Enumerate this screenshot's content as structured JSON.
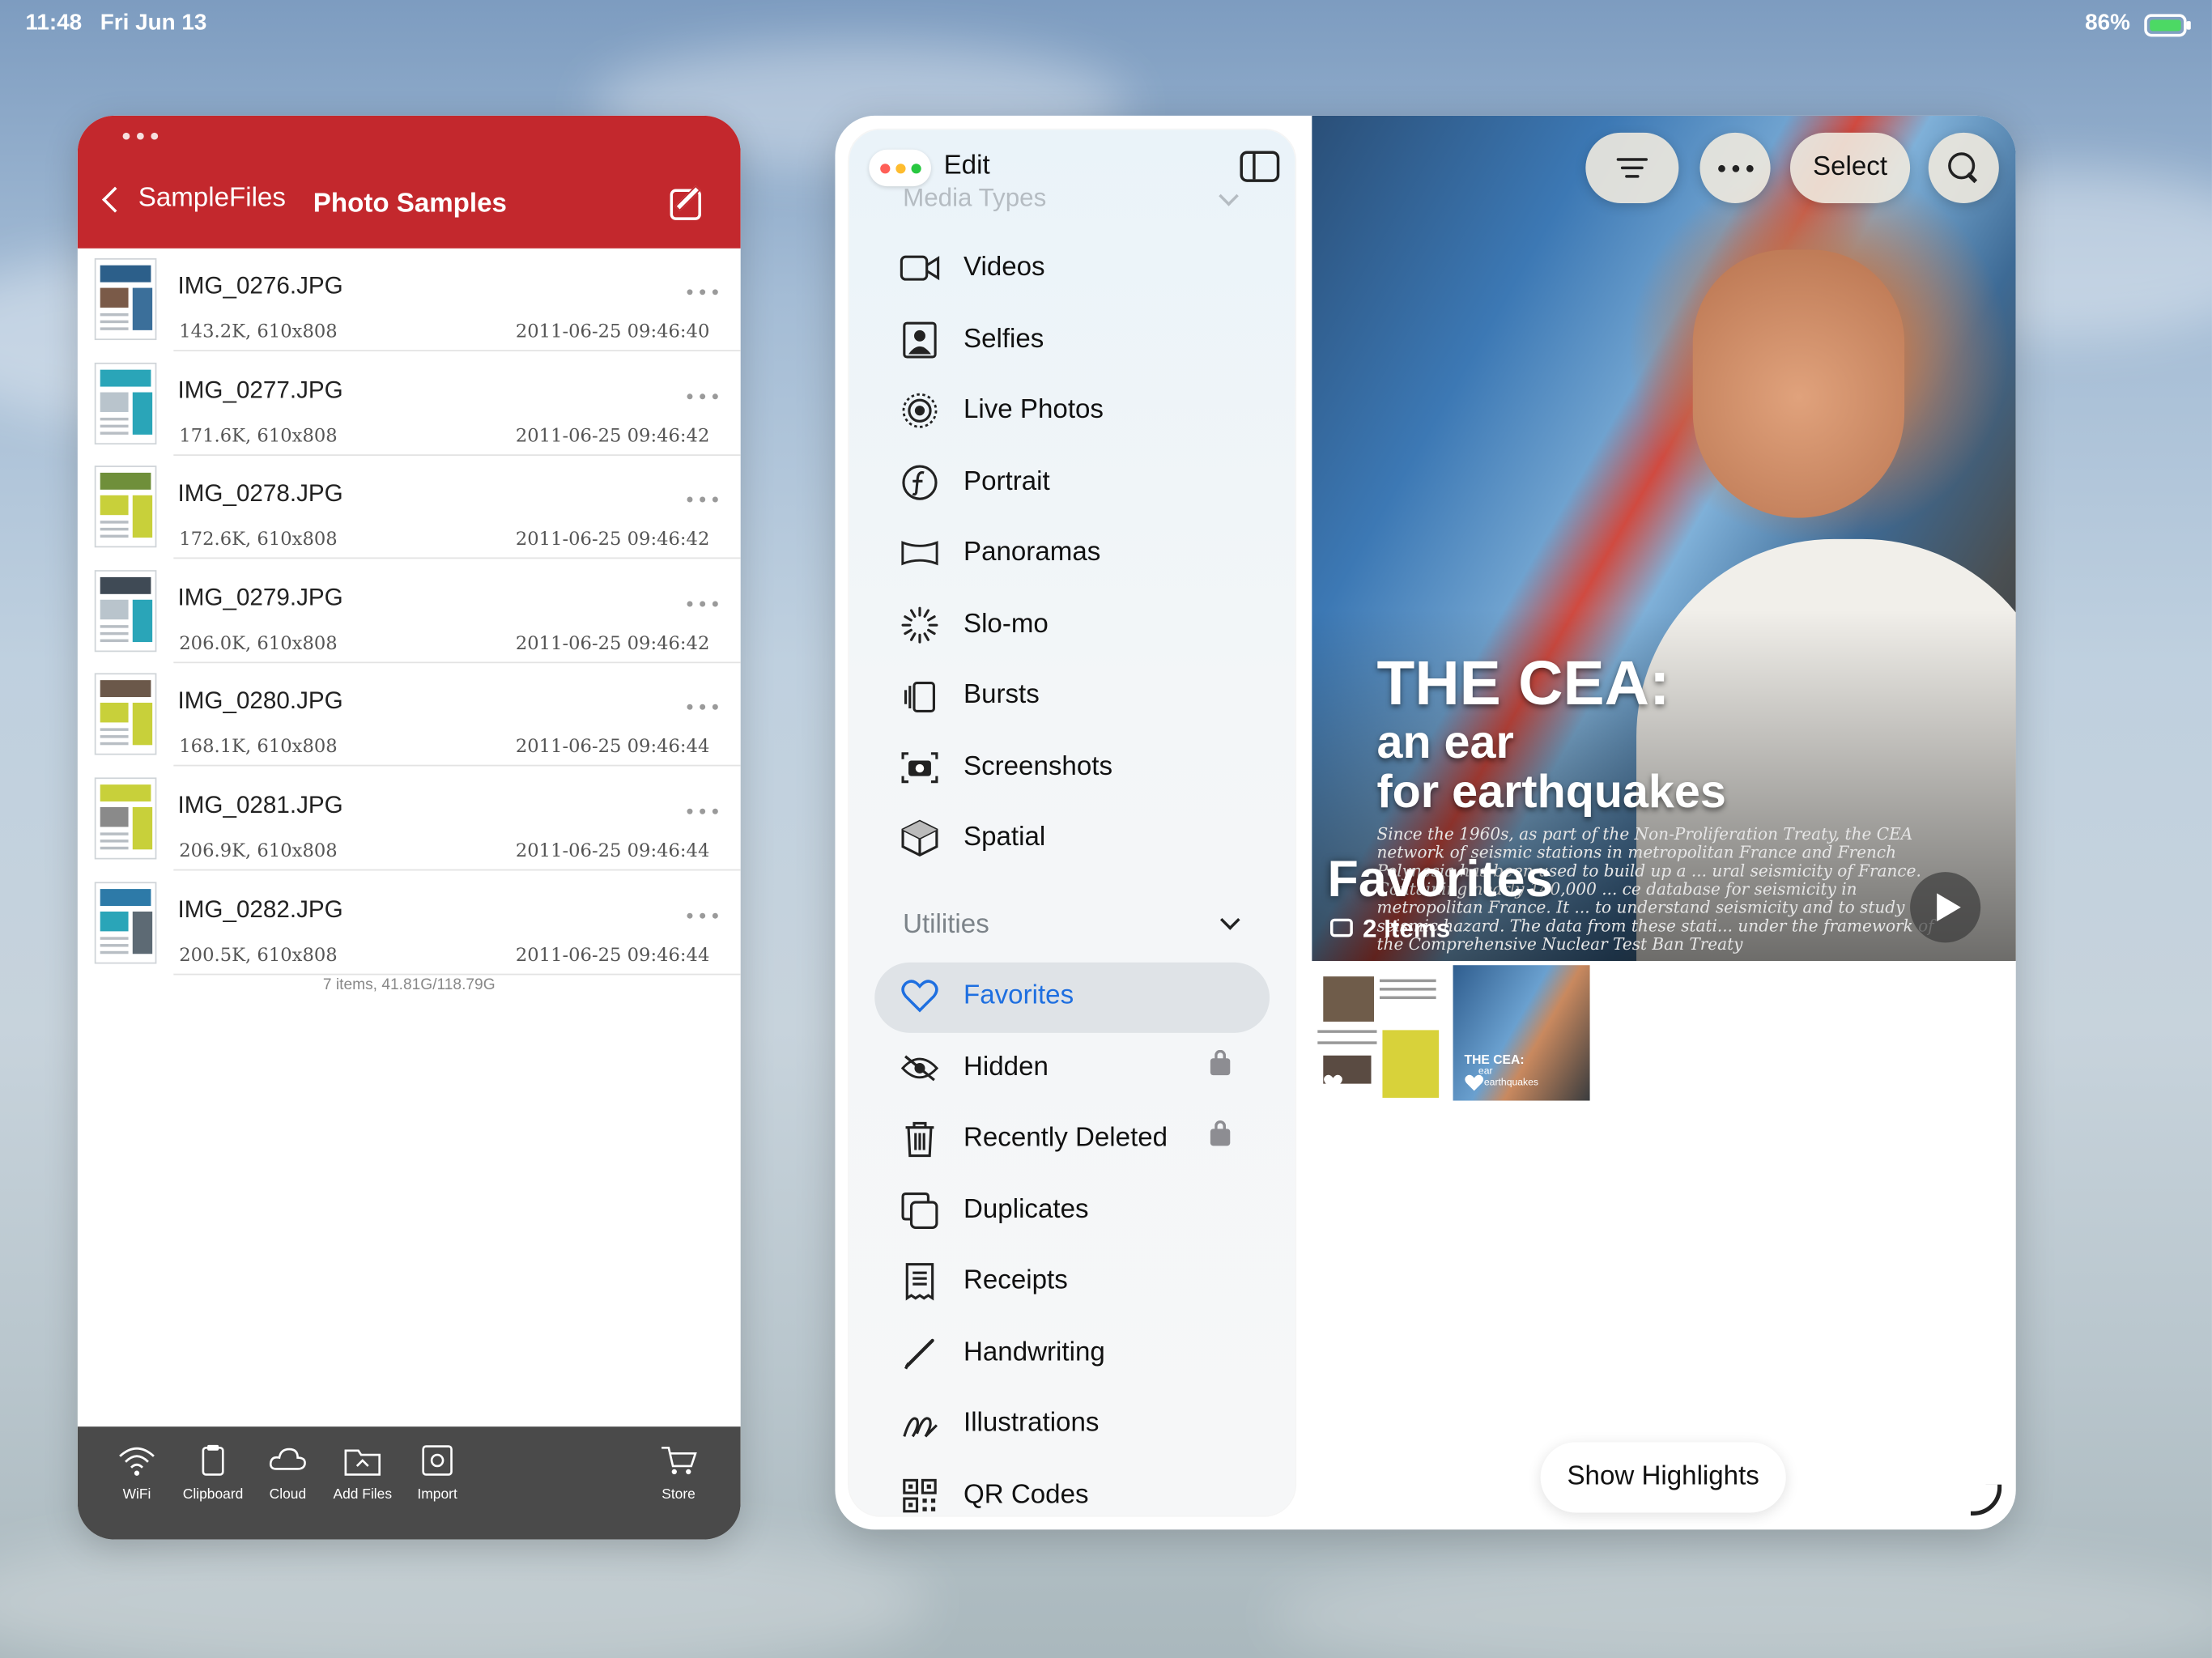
{
  "status_bar": {
    "time": "11:48",
    "date": "Fri Jun 13",
    "battery": "86%"
  },
  "left_app": {
    "back_label": "SampleFiles",
    "title": "Photo Samples",
    "files": [
      {
        "name": "IMG_0276.JPG",
        "meta": "143.2K, 610x808",
        "date": "2011-06-25 09:46:40"
      },
      {
        "name": "IMG_0277.JPG",
        "meta": "171.6K, 610x808",
        "date": "2011-06-25 09:46:42"
      },
      {
        "name": "IMG_0278.JPG",
        "meta": "172.6K, 610x808",
        "date": "2011-06-25 09:46:42"
      },
      {
        "name": "IMG_0279.JPG",
        "meta": "206.0K, 610x808",
        "date": "2011-06-25 09:46:42"
      },
      {
        "name": "IMG_0280.JPG",
        "meta": "168.1K, 610x808",
        "date": "2011-06-25 09:46:44"
      },
      {
        "name": "IMG_0281.JPG",
        "meta": "206.9K, 610x808",
        "date": "2011-06-25 09:46:44"
      },
      {
        "name": "IMG_0282.JPG",
        "meta": "200.5K, 610x808",
        "date": "2011-06-25 09:46:44"
      }
    ],
    "footer": "7 items, 41.81G/118.79G",
    "toolbar": [
      "WiFi",
      "Clipboard",
      "Cloud",
      "Add Files",
      "Import",
      "Store"
    ]
  },
  "photos": {
    "edit_label": "Edit",
    "section_media": "Media Types",
    "media_items": [
      "Videos",
      "Selfies",
      "Live Photos",
      "Portrait",
      "Panoramas",
      "Slo-mo",
      "Bursts",
      "Screenshots",
      "Spatial"
    ],
    "section_utilities": "Utilities",
    "utility_items": [
      "Favorites",
      "Hidden",
      "Recently Deleted",
      "Duplicates",
      "Receipts",
      "Handwriting",
      "Illustrations",
      "QR Codes"
    ],
    "selected": "Favorites",
    "select_button": "Select",
    "album_title": "Favorites",
    "album_count": "2 Items",
    "hero_title": "THE CEA:",
    "hero_sub1": "an ear",
    "hero_sub2": "for earthquakes",
    "hero_body": "Since the 1960s, as part of the Non-Proliferation Treaty, the CEA network of seismic stations in metropolitan France and French Polynesia has been used to build up a ... ural seismicity of France. Containing nearly 140,000 ... ce database for seismicity in metropolitan France. It ... to understand seismicity and to study seismic hazard. The data from these stati... under the framework of the Comprehensive Nuclear Test Ban Treaty",
    "thumb2_label1": "THE CEA:",
    "thumb2_label2": "ear",
    "thumb2_label3": "earthquakes",
    "show_highlights": "Show Highlights",
    "accent": "#1e6fe0"
  }
}
